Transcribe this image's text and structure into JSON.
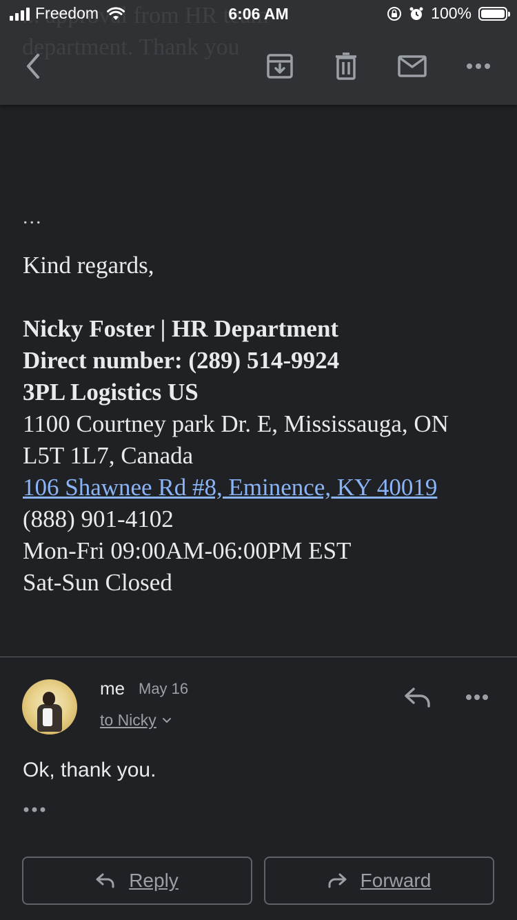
{
  "status_bar": {
    "carrier": "Freedom",
    "time": "6:06 AM",
    "battery": "100%"
  },
  "toolbar": {
    "ghost_line1": "... approval from HR team",
    "ghost_line2": "department. Thank you"
  },
  "email": {
    "ellipsis": "...",
    "closing": "Kind regards,",
    "signature": {
      "name_line": "Nicky Foster | HR Department",
      "direct_line": "Direct number: (289) 514-9924",
      "company": "3PL Logistics US",
      "address_line1": "1100 Courtney park Dr. E, Mississauga, ON",
      "address_line2": "L5T 1L7, Canada",
      "us_address_link": "106 Shawnee Rd #8, Eminence, KY 40019",
      "phone": "(888) 901-4102",
      "hours_weekday": "Mon-Fri 09:00AM-06:00PM EST",
      "hours_weekend": "Sat-Sun Closed"
    }
  },
  "reply_message": {
    "sender": "me",
    "date": "May 16",
    "recipient": "to Nicky",
    "body": "Ok, thank you."
  },
  "actions": {
    "reply_label": "Reply",
    "forward_label": "Forward"
  },
  "colors": {
    "background": "#202124",
    "toolbar": "#303134",
    "link": "#8ab4f8",
    "muted": "#9aa0a6"
  }
}
